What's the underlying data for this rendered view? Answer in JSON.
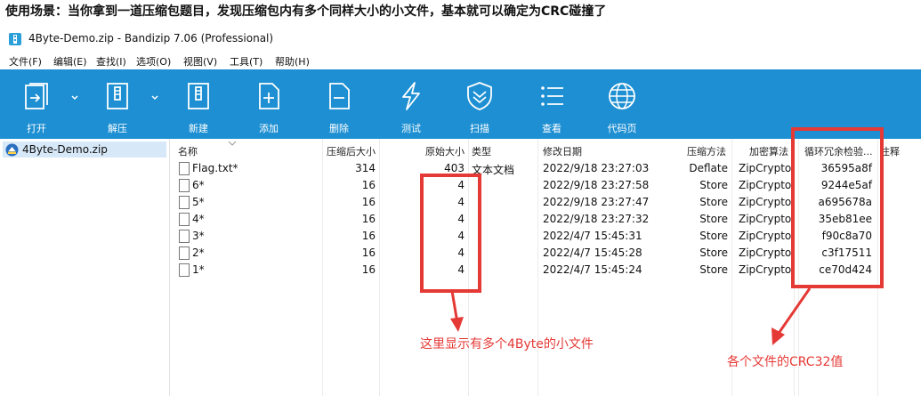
{
  "heading": "使用场景：当你拿到一道压缩包题目，发现压缩包内有多个同样大小的小文件，基本就可以确定为CRC碰撞了",
  "window": {
    "title": "4Byte-Demo.zip - Bandizip 7.06 (Professional)"
  },
  "menu": [
    "文件(F)",
    "编辑(E)",
    "查找(I)",
    "选项(O)",
    "视图(V)",
    "工具(T)",
    "帮助(H)"
  ],
  "toolbar": [
    {
      "label": "打开",
      "icon": "open-icon"
    },
    {
      "label": "解压",
      "icon": "extract-icon"
    },
    {
      "label": "新建",
      "icon": "new-archive-icon"
    },
    {
      "label": "添加",
      "icon": "add-icon"
    },
    {
      "label": "删除",
      "icon": "delete-icon"
    },
    {
      "label": "测试",
      "icon": "test-icon"
    },
    {
      "label": "扫描",
      "icon": "scan-icon"
    },
    {
      "label": "查看",
      "icon": "view-icon"
    },
    {
      "label": "代码页",
      "icon": "codepage-icon"
    }
  ],
  "tree": {
    "root": "4Byte-Demo.zip"
  },
  "columns": {
    "name": "名称",
    "packed": "压缩后大小",
    "size": "原始大小",
    "type": "类型",
    "modified": "修改日期",
    "method": "压缩方法",
    "encryption": "加密算法",
    "crc": "循环冗余检验...",
    "comment": "注释"
  },
  "files": [
    {
      "name": "Flag.txt*",
      "packed": "314",
      "size": "403",
      "type": "文本文档",
      "modified": "2022/9/18 23:27:03",
      "method": "Deflate",
      "encryption": "ZipCrypto",
      "crc": "36595a8f"
    },
    {
      "name": "6*",
      "packed": "16",
      "size": "4",
      "type": "",
      "modified": "2022/9/18 23:27:58",
      "method": "Store",
      "encryption": "ZipCrypto",
      "crc": "9244e5af"
    },
    {
      "name": "5*",
      "packed": "16",
      "size": "4",
      "type": "",
      "modified": "2022/9/18 23:27:47",
      "method": "Store",
      "encryption": "ZipCrypto",
      "crc": "a695678a"
    },
    {
      "name": "4*",
      "packed": "16",
      "size": "4",
      "type": "",
      "modified": "2022/9/18 23:27:32",
      "method": "Store",
      "encryption": "ZipCrypto",
      "crc": "35eb81ee"
    },
    {
      "name": "3*",
      "packed": "16",
      "size": "4",
      "type": "",
      "modified": "2022/4/7 15:45:31",
      "method": "Store",
      "encryption": "ZipCrypto",
      "crc": "f90c8a70"
    },
    {
      "name": "2*",
      "packed": "16",
      "size": "4",
      "type": "",
      "modified": "2022/4/7 15:45:28",
      "method": "Store",
      "encryption": "ZipCrypto",
      "crc": "c3f17511"
    },
    {
      "name": "1*",
      "packed": "16",
      "size": "4",
      "type": "",
      "modified": "2022/4/7 15:45:24",
      "method": "Store",
      "encryption": "ZipCrypto",
      "crc": "ce70d424"
    }
  ],
  "annotations": {
    "size_note": "这里显示有多个4Byte的小文件",
    "crc_note": "各个文件的CRC32值",
    "color": "#e53935"
  },
  "colors": {
    "toolbar": "#1d8fd2",
    "selection": "#d7e8f8"
  }
}
